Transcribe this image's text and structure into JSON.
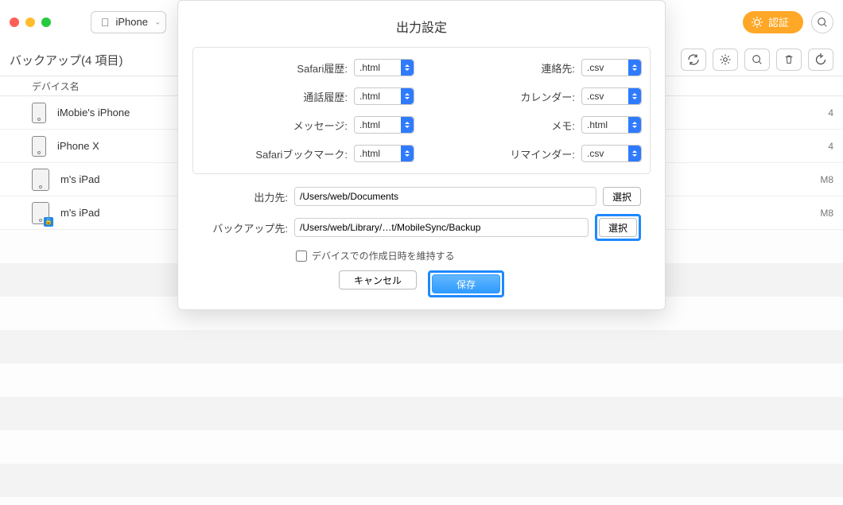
{
  "toolbar": {
    "device_name": "iPhone",
    "auth_label": "認証"
  },
  "subbar": {
    "title": "バックアップ(4 項目)"
  },
  "table": {
    "col_device": "デバイス名"
  },
  "devices": [
    {
      "name": "iMobie's iPhone",
      "trail": "4",
      "kind": "phone",
      "locked": false
    },
    {
      "name": "iPhone X",
      "trail": "4",
      "kind": "phone",
      "locked": false
    },
    {
      "name": "m's iPad",
      "trail": "M8",
      "kind": "tablet",
      "locked": false
    },
    {
      "name": "m's iPad",
      "trail": "M8",
      "kind": "tablet",
      "locked": true
    }
  ],
  "modal": {
    "title": "出力設定",
    "left": [
      {
        "label": "Safari履歴:",
        "value": ".html"
      },
      {
        "label": "通話履歴:",
        "value": ".html"
      },
      {
        "label": "メッセージ:",
        "value": ".html"
      },
      {
        "label": "Safariブックマーク:",
        "value": ".html"
      }
    ],
    "right": [
      {
        "label": "連絡先:",
        "value": ".csv"
      },
      {
        "label": "カレンダー:",
        "value": ".csv"
      },
      {
        "label": "メモ:",
        "value": ".html"
      },
      {
        "label": "リマインダー:",
        "value": ".csv"
      }
    ],
    "out_label": "出力先:",
    "out_path": "/Users/web/Documents",
    "backup_label": "バックアップ先:",
    "backup_path": "/Users/web/Library/…t/MobileSync/Backup",
    "choose": "選択",
    "keep_date": "デバイスでの作成日時を維持する",
    "cancel": "キャンセル",
    "save": "保存"
  }
}
